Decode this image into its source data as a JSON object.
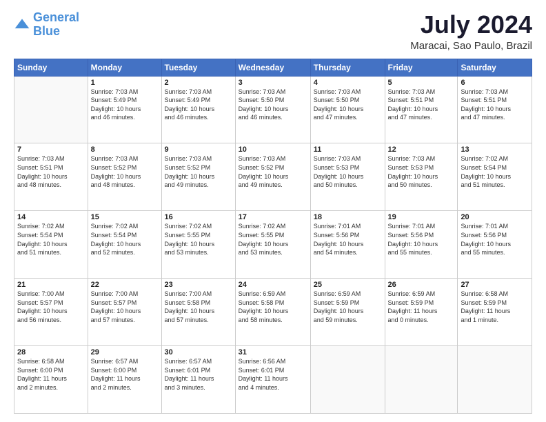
{
  "logo": {
    "line1": "General",
    "line2": "Blue"
  },
  "title": "July 2024",
  "location": "Maracai, Sao Paulo, Brazil",
  "days_header": [
    "Sunday",
    "Monday",
    "Tuesday",
    "Wednesday",
    "Thursday",
    "Friday",
    "Saturday"
  ],
  "weeks": [
    [
      {
        "num": "",
        "info": ""
      },
      {
        "num": "1",
        "info": "Sunrise: 7:03 AM\nSunset: 5:49 PM\nDaylight: 10 hours\nand 46 minutes."
      },
      {
        "num": "2",
        "info": "Sunrise: 7:03 AM\nSunset: 5:49 PM\nDaylight: 10 hours\nand 46 minutes."
      },
      {
        "num": "3",
        "info": "Sunrise: 7:03 AM\nSunset: 5:50 PM\nDaylight: 10 hours\nand 46 minutes."
      },
      {
        "num": "4",
        "info": "Sunrise: 7:03 AM\nSunset: 5:50 PM\nDaylight: 10 hours\nand 47 minutes."
      },
      {
        "num": "5",
        "info": "Sunrise: 7:03 AM\nSunset: 5:51 PM\nDaylight: 10 hours\nand 47 minutes."
      },
      {
        "num": "6",
        "info": "Sunrise: 7:03 AM\nSunset: 5:51 PM\nDaylight: 10 hours\nand 47 minutes."
      }
    ],
    [
      {
        "num": "7",
        "info": "Sunrise: 7:03 AM\nSunset: 5:51 PM\nDaylight: 10 hours\nand 48 minutes."
      },
      {
        "num": "8",
        "info": "Sunrise: 7:03 AM\nSunset: 5:52 PM\nDaylight: 10 hours\nand 48 minutes."
      },
      {
        "num": "9",
        "info": "Sunrise: 7:03 AM\nSunset: 5:52 PM\nDaylight: 10 hours\nand 49 minutes."
      },
      {
        "num": "10",
        "info": "Sunrise: 7:03 AM\nSunset: 5:52 PM\nDaylight: 10 hours\nand 49 minutes."
      },
      {
        "num": "11",
        "info": "Sunrise: 7:03 AM\nSunset: 5:53 PM\nDaylight: 10 hours\nand 50 minutes."
      },
      {
        "num": "12",
        "info": "Sunrise: 7:03 AM\nSunset: 5:53 PM\nDaylight: 10 hours\nand 50 minutes."
      },
      {
        "num": "13",
        "info": "Sunrise: 7:02 AM\nSunset: 5:54 PM\nDaylight: 10 hours\nand 51 minutes."
      }
    ],
    [
      {
        "num": "14",
        "info": "Sunrise: 7:02 AM\nSunset: 5:54 PM\nDaylight: 10 hours\nand 51 minutes."
      },
      {
        "num": "15",
        "info": "Sunrise: 7:02 AM\nSunset: 5:54 PM\nDaylight: 10 hours\nand 52 minutes."
      },
      {
        "num": "16",
        "info": "Sunrise: 7:02 AM\nSunset: 5:55 PM\nDaylight: 10 hours\nand 53 minutes."
      },
      {
        "num": "17",
        "info": "Sunrise: 7:02 AM\nSunset: 5:55 PM\nDaylight: 10 hours\nand 53 minutes."
      },
      {
        "num": "18",
        "info": "Sunrise: 7:01 AM\nSunset: 5:56 PM\nDaylight: 10 hours\nand 54 minutes."
      },
      {
        "num": "19",
        "info": "Sunrise: 7:01 AM\nSunset: 5:56 PM\nDaylight: 10 hours\nand 55 minutes."
      },
      {
        "num": "20",
        "info": "Sunrise: 7:01 AM\nSunset: 5:56 PM\nDaylight: 10 hours\nand 55 minutes."
      }
    ],
    [
      {
        "num": "21",
        "info": "Sunrise: 7:00 AM\nSunset: 5:57 PM\nDaylight: 10 hours\nand 56 minutes."
      },
      {
        "num": "22",
        "info": "Sunrise: 7:00 AM\nSunset: 5:57 PM\nDaylight: 10 hours\nand 57 minutes."
      },
      {
        "num": "23",
        "info": "Sunrise: 7:00 AM\nSunset: 5:58 PM\nDaylight: 10 hours\nand 57 minutes."
      },
      {
        "num": "24",
        "info": "Sunrise: 6:59 AM\nSunset: 5:58 PM\nDaylight: 10 hours\nand 58 minutes."
      },
      {
        "num": "25",
        "info": "Sunrise: 6:59 AM\nSunset: 5:59 PM\nDaylight: 10 hours\nand 59 minutes."
      },
      {
        "num": "26",
        "info": "Sunrise: 6:59 AM\nSunset: 5:59 PM\nDaylight: 11 hours\nand 0 minutes."
      },
      {
        "num": "27",
        "info": "Sunrise: 6:58 AM\nSunset: 5:59 PM\nDaylight: 11 hours\nand 1 minute."
      }
    ],
    [
      {
        "num": "28",
        "info": "Sunrise: 6:58 AM\nSunset: 6:00 PM\nDaylight: 11 hours\nand 2 minutes."
      },
      {
        "num": "29",
        "info": "Sunrise: 6:57 AM\nSunset: 6:00 PM\nDaylight: 11 hours\nand 2 minutes."
      },
      {
        "num": "30",
        "info": "Sunrise: 6:57 AM\nSunset: 6:01 PM\nDaylight: 11 hours\nand 3 minutes."
      },
      {
        "num": "31",
        "info": "Sunrise: 6:56 AM\nSunset: 6:01 PM\nDaylight: 11 hours\nand 4 minutes."
      },
      {
        "num": "",
        "info": ""
      },
      {
        "num": "",
        "info": ""
      },
      {
        "num": "",
        "info": ""
      }
    ]
  ]
}
